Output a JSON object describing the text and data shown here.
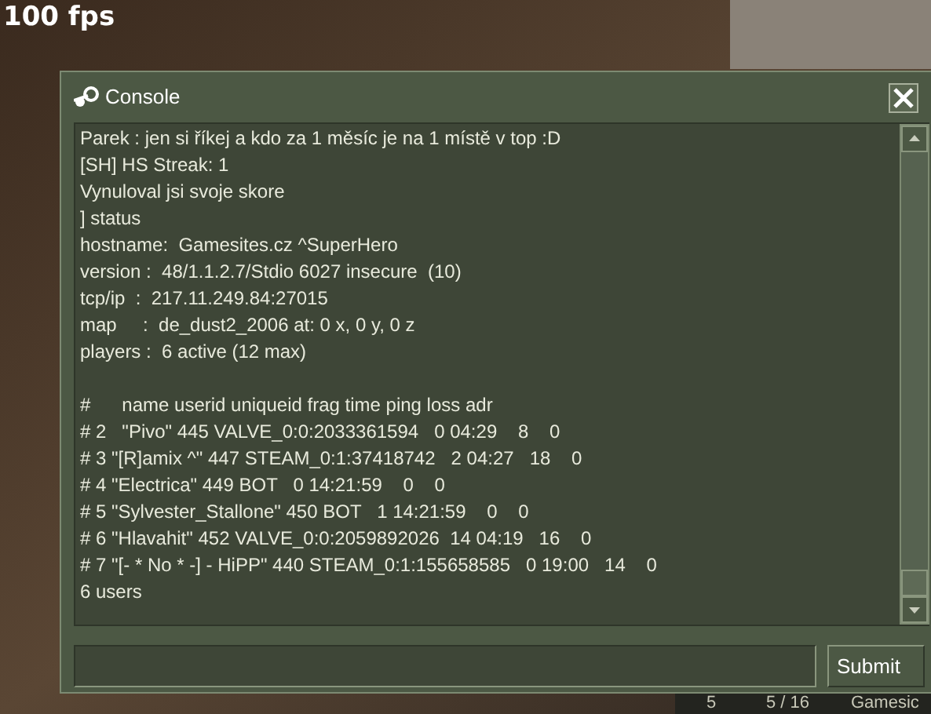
{
  "fps_counter": "100 fps",
  "console": {
    "title": "Console",
    "blocks": [
      [
        "Parek : jen si říkej a kdo za 1 měsíc je na 1 místě v top :D",
        "[SH] HS Streak: 1",
        "Vynuloval jsi svoje skore",
        "] status",
        "hostname:  Gamesites.cz ^SuperHero",
        "version :  48/1.1.2.7/Stdio 6027 insecure  (10)",
        "tcp/ip  :  217.11.249.84:27015",
        "map     :  de_dust2_2006 at: 0 x, 0 y, 0 z",
        "players :  6 active (12 max)"
      ],
      [
        "#      name userid uniqueid frag time ping loss adr",
        "# 2   \"Pivo\" 445 VALVE_0:0:2033361594   0 04:29    8    0",
        "# 3 \"[R]amix ^\" 447 STEAM_0:1:37418742   2 04:27   18    0",
        "# 4 \"Electrica\" 449 BOT   0 14:21:59    0    0",
        "# 5 \"Sylvester_Stallone\" 450 BOT   1 14:21:59    0    0",
        "# 6 \"Hlavahit\" 452 VALVE_0:0:2059892026  14 04:19   16    0",
        "# 7 \"[- * No * -] - HiPP\" 440 STEAM_0:1:155658585   0 19:00   14    0",
        "6 users"
      ]
    ],
    "submit": "Submit"
  },
  "scoreboard_row": [
    "5",
    "5 / 16",
    "Gamesic"
  ]
}
